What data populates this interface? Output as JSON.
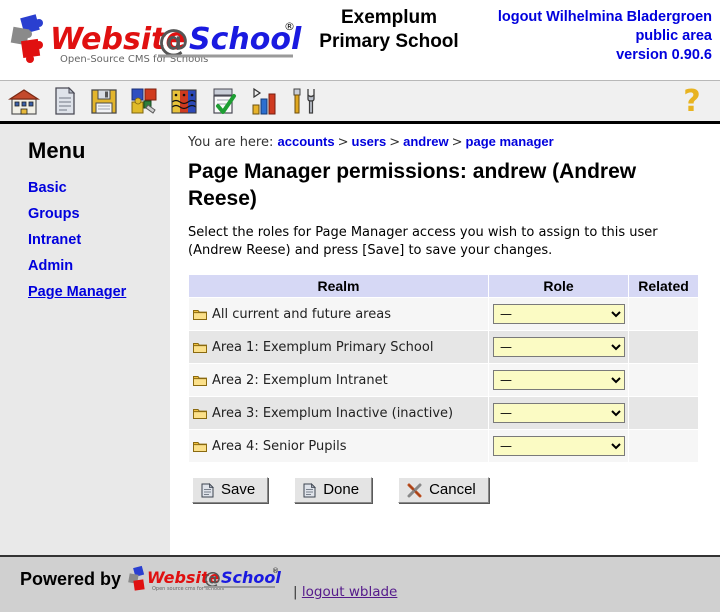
{
  "header": {
    "logo_word1": "Website",
    "logo_at": "@",
    "logo_word2": "School",
    "logo_reg": "®",
    "logo_tagline": "Open-Source CMS for Schools",
    "school_name_line1": "Exemplum",
    "school_name_line2": "Primary School",
    "logout_text": "logout Wilhelmina Bladergroen",
    "area_text": "public area",
    "version_text": "version 0.90.6"
  },
  "toolbar": {
    "items": [
      {
        "name": "home-icon",
        "title": "Home"
      },
      {
        "name": "page-icon",
        "title": "Page"
      },
      {
        "name": "save-disk-icon",
        "title": "Save"
      },
      {
        "name": "modules-icon",
        "title": "Modules"
      },
      {
        "name": "users-icon",
        "title": "Users"
      },
      {
        "name": "approve-icon",
        "title": "Approve"
      },
      {
        "name": "statistics-icon",
        "title": "Statistics"
      },
      {
        "name": "tools-icon",
        "title": "Tools"
      }
    ],
    "help_label": "?"
  },
  "sidebar": {
    "title": "Menu",
    "items": [
      {
        "label": "Basic",
        "current": false
      },
      {
        "label": "Groups",
        "current": false
      },
      {
        "label": "Intranet",
        "current": false
      },
      {
        "label": "Admin",
        "current": false
      },
      {
        "label": "Page Manager",
        "current": true
      }
    ]
  },
  "content": {
    "breadcrumb_prefix": "You are here:",
    "breadcrumb": [
      "accounts",
      "users",
      "andrew",
      "page manager"
    ],
    "breadcrumb_separator": ">",
    "page_title": "Page Manager permissions: andrew (Andrew Reese)",
    "intro": "Select the roles for Page Manager access you wish to assign to this user (Andrew Reese) and press [Save] to save your changes.",
    "table": {
      "headers": [
        "Realm",
        "Role",
        "Related"
      ],
      "rows": [
        {
          "realm": "All current and future areas",
          "role": "—",
          "related": ""
        },
        {
          "realm": "Area 1: Exemplum Primary School",
          "role": "—",
          "related": ""
        },
        {
          "realm": "Area 2: Exemplum Intranet",
          "role": "—",
          "related": ""
        },
        {
          "realm": "Area 3: Exemplum Inactive (inactive)",
          "role": "—",
          "related": ""
        },
        {
          "realm": "Area 4: Senior Pupils",
          "role": "—",
          "related": ""
        }
      ],
      "role_options": [
        "—"
      ]
    },
    "buttons": [
      {
        "label": "Save",
        "icon": "page-icon"
      },
      {
        "label": "Done",
        "icon": "page-icon"
      },
      {
        "label": "Cancel",
        "icon": "cross-tools-icon"
      }
    ]
  },
  "footer": {
    "powered_by": "Powered by",
    "logo_word1": "Website",
    "logo_at": "@",
    "logo_word2": "School",
    "logo_reg": "®",
    "logo_tagline": "Open source cms for schools",
    "separator": "|",
    "logout_label": "logout wblade"
  },
  "colors": {
    "link": "#0000dd",
    "table_header_bg": "#d6d8f5",
    "select_bg": "#fbfbc4",
    "sidebar_bg": "#e9e9e9",
    "footer_bg": "#d0d0d0"
  }
}
